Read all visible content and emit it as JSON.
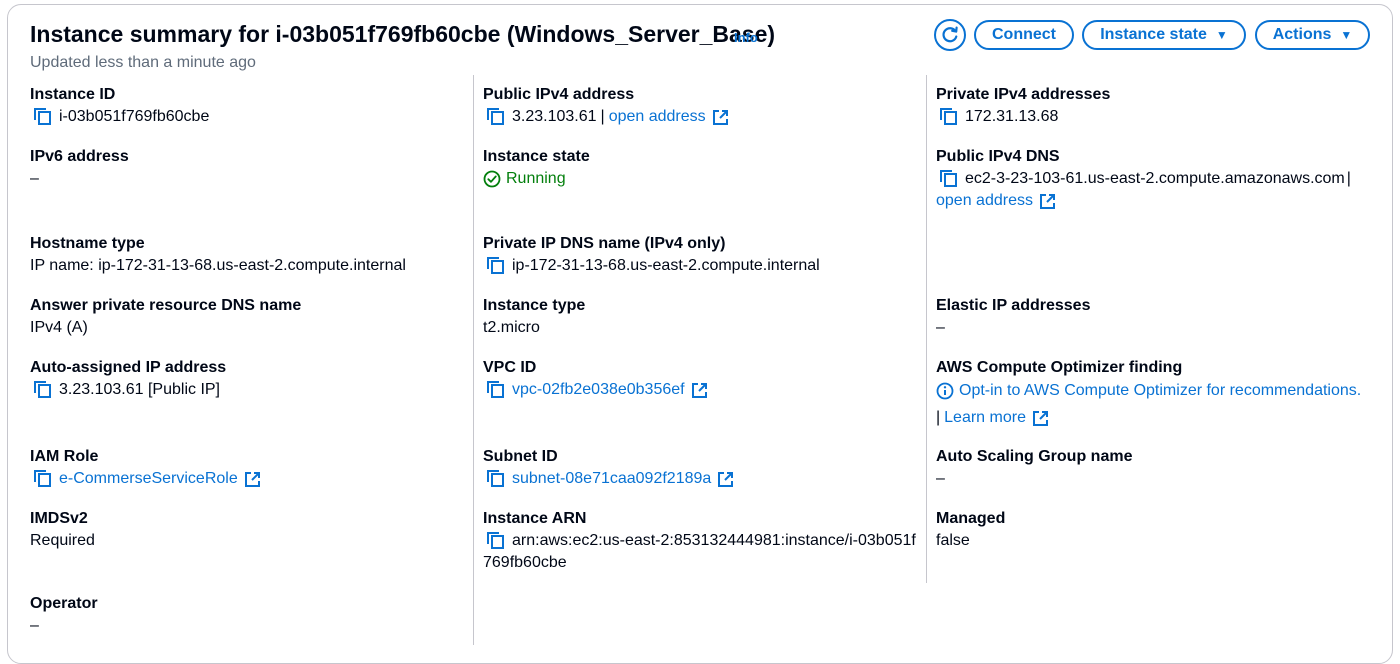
{
  "header": {
    "title": "Instance summary for i-03b051f769fb60cbe (Windows_Server_Base)",
    "info_label": "Info",
    "updated": "Updated less than a minute ago",
    "connect_label": "Connect",
    "instance_state_label": "Instance state",
    "actions_label": "Actions"
  },
  "col1": {
    "instance_id": {
      "label": "Instance ID",
      "value": "i-03b051f769fb60cbe"
    },
    "ipv6": {
      "label": "IPv6 address",
      "value": "–"
    },
    "hostname_type": {
      "label": "Hostname type",
      "value": "IP name: ip-172-31-13-68.us-east-2.compute.internal"
    },
    "answer_dns": {
      "label": "Answer private resource DNS name",
      "value": "IPv4 (A)"
    },
    "auto_ip": {
      "label": "Auto-assigned IP address",
      "value": "3.23.103.61 [Public IP]"
    },
    "iam_role": {
      "label": "IAM Role",
      "value": "e-CommerseServiceRole"
    },
    "imdsv2": {
      "label": "IMDSv2",
      "value": "Required"
    },
    "operator": {
      "label": "Operator",
      "value": "–"
    }
  },
  "col2": {
    "public_ipv4": {
      "label": "Public IPv4 address",
      "value": "3.23.103.61",
      "sep": "|",
      "link": "open address"
    },
    "instance_state": {
      "label": "Instance state",
      "value": "Running"
    },
    "private_dns": {
      "label": "Private IP DNS name (IPv4 only)",
      "value": "ip-172-31-13-68.us-east-2.compute.internal"
    },
    "instance_type": {
      "label": "Instance type",
      "value": "t2.micro"
    },
    "vpc_id": {
      "label": "VPC ID",
      "value": "vpc-02fb2e038e0b356ef"
    },
    "subnet_id": {
      "label": "Subnet ID",
      "value": "subnet-08e71caa092f2189a"
    },
    "arn": {
      "label": "Instance ARN",
      "value_line1": "arn:aws:ec2:us-east-2:853132444981:instance/i-03b051f",
      "value_line2": "769fb60cbe"
    }
  },
  "col3": {
    "private_ipv4": {
      "label": "Private IPv4 addresses",
      "value": "172.31.13.68"
    },
    "public_dns": {
      "label": "Public IPv4 DNS",
      "value": "ec2-3-23-103-61.us-east-2.compute.amazonaws.com",
      "sep": "|",
      "link": "open address"
    },
    "elastic_ip": {
      "label": "Elastic IP addresses",
      "value": "–"
    },
    "optimizer": {
      "label": "AWS Compute Optimizer finding",
      "link": "Opt-in to AWS Compute Optimizer for recommendations.",
      "sep": "|",
      "learn_more": "Learn more"
    },
    "asg": {
      "label": "Auto Scaling Group name",
      "value": "–"
    },
    "managed": {
      "label": "Managed",
      "value": "false"
    }
  },
  "colors": {
    "link": "#0972d3",
    "running": "#037f0c",
    "border": "#c6c6cd"
  },
  "icons": [
    "refresh-icon",
    "copy-icon",
    "external-link-icon",
    "check-circle-icon",
    "info-circle-icon",
    "caret-down-icon"
  ]
}
